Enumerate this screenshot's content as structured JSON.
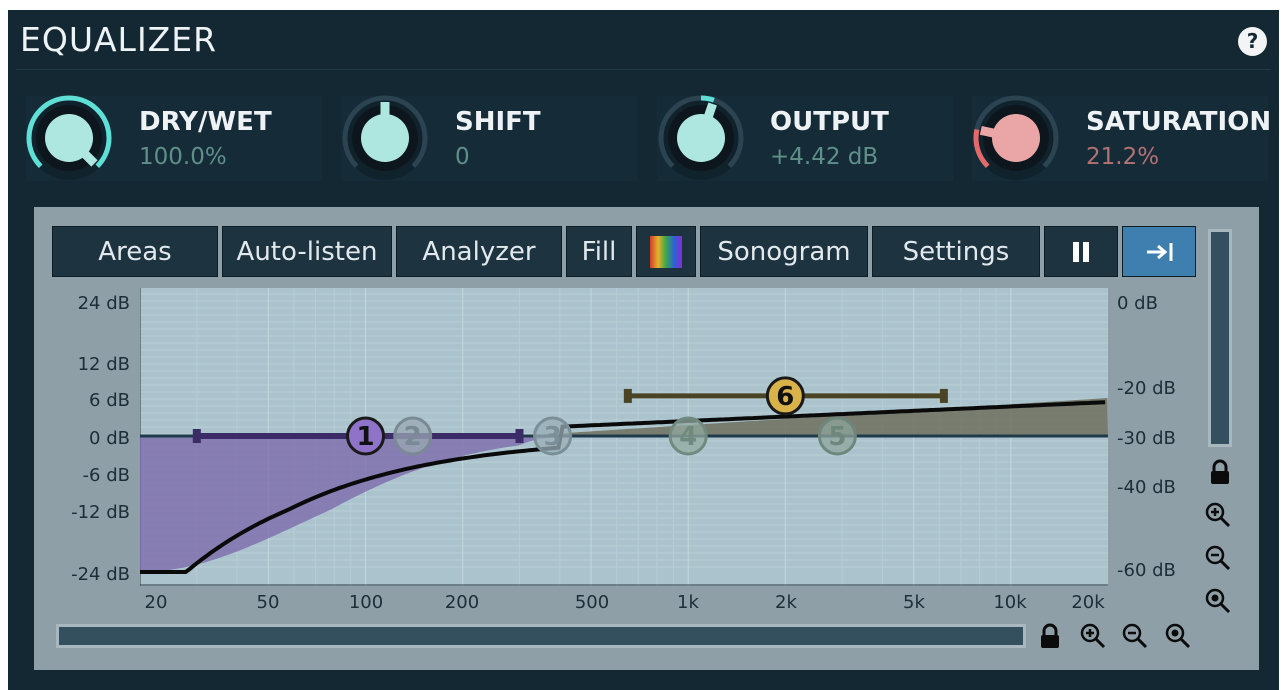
{
  "header": {
    "title": "EQUALIZER",
    "help_label": "?"
  },
  "knobs": [
    {
      "name": "DRY/WET",
      "value": "100.0%",
      "value_color": "#5f8f88",
      "cap_color": "#aee6e0",
      "arc_color": "#5fe0d6",
      "level": 1.0
    },
    {
      "name": "SHIFT",
      "value": "0",
      "value_color": "#5f8f88",
      "cap_color": "#aee6e0",
      "arc_color": "#5fe0d6",
      "level": 0.5
    },
    {
      "name": "OUTPUT",
      "value": "+4.42 dB",
      "value_color": "#5f8f88",
      "cap_color": "#aee6e0",
      "arc_color": "#5fe0d6",
      "level": 0.57
    },
    {
      "name": "SATURATION",
      "value": "21.2%",
      "value_color": "#b27272",
      "cap_color": "#eaa6a6",
      "arc_color": "#e46a6a",
      "level": 0.212
    }
  ],
  "toolbar": {
    "areas": "Areas",
    "auto_listen": "Auto-listen",
    "analyzer": "Analyzer",
    "fill": "Fill",
    "sonogram": "Sonogram",
    "settings": "Settings"
  },
  "graph": {
    "left_axis": [
      "24 dB",
      "12 dB",
      "6 dB",
      "0 dB",
      "-6 dB",
      "-12 dB",
      "-24 dB"
    ],
    "right_axis": [
      "0 dB",
      "-20 dB",
      "-30 dB",
      "-40 dB",
      "-60 dB"
    ],
    "freq_axis": [
      "20",
      "50",
      "100",
      "200",
      "500",
      "1k",
      "2k",
      "5k",
      "10k",
      "20k"
    ],
    "bands": [
      "1",
      "2",
      "3",
      "4",
      "5",
      "6"
    ]
  },
  "colors": {
    "accent_blue": "#3e7fb0",
    "band1": "#8e73c9",
    "band6": "#d9b24a",
    "curve": "#0a0a0a"
  }
}
